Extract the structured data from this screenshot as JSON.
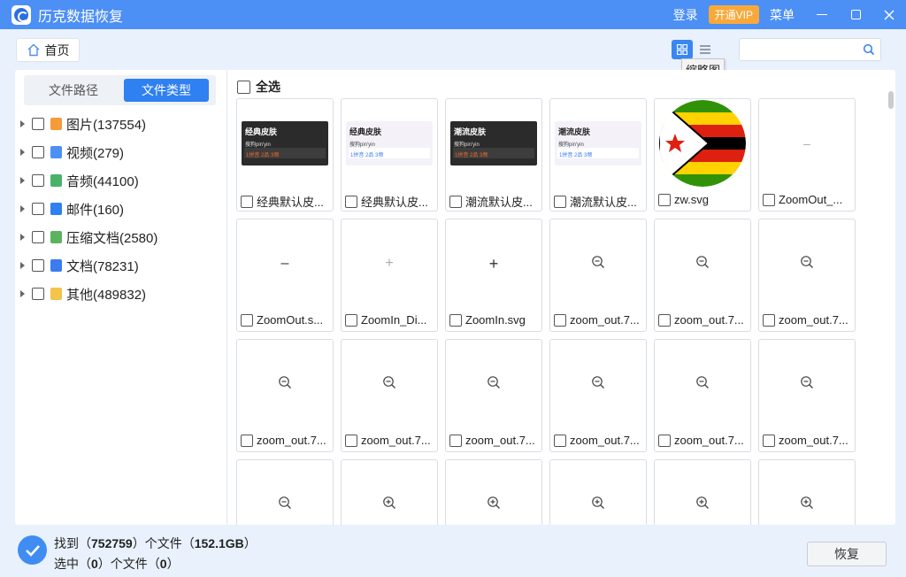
{
  "titlebar": {
    "app_title": "历克数据恢复",
    "login": "登录",
    "vip": "开通VIP",
    "menu": "菜单"
  },
  "toolbar": {
    "home": "首页",
    "tooltip": "缩略图",
    "search_value": "",
    "search_placeholder": ""
  },
  "left": {
    "tab_path": "文件路径",
    "tab_type": "文件类型",
    "items": [
      {
        "label": "图片(137554)",
        "icon": "image-icon",
        "color": "#f59b3a"
      },
      {
        "label": "视频(279)",
        "icon": "video-icon",
        "color": "#4c8ff5"
      },
      {
        "label": "音频(44100)",
        "icon": "audio-icon",
        "color": "#48b26a"
      },
      {
        "label": "邮件(160)",
        "icon": "mail-icon",
        "color": "#2f80f0"
      },
      {
        "label": "压缩文档(2580)",
        "icon": "archive-icon",
        "color": "#5bb35f"
      },
      {
        "label": "文档(78231)",
        "icon": "document-icon",
        "color": "#3b7cf1"
      },
      {
        "label": "其他(489832)",
        "icon": "folder-icon",
        "color": "#f3c34a"
      }
    ]
  },
  "grid": {
    "select_all": "全选",
    "skins": [
      {
        "title": "经典皮肤",
        "line": "搜狗pin'yin",
        "opts": "1拼音 2品 3频"
      },
      {
        "title": "经典皮肤",
        "line": "搜狗pin'yin",
        "opts": "1拼音 2品 3频"
      },
      {
        "title": "潮流皮肤",
        "line": "搜狗pin'yin",
        "opts": "1拼音 2品 3频"
      },
      {
        "title": "潮流皮肤",
        "line": "搜狗pin'yin",
        "opts": "1拼音 2品 3频"
      }
    ],
    "cards": [
      "经典默认皮...",
      "经典默认皮...",
      "潮流默认皮...",
      "潮流默认皮...",
      "zw.svg",
      "ZoomOut_...",
      "ZoomOut.s...",
      "ZoomIn_Di...",
      "ZoomIn.svg",
      "zoom_out.7...",
      "zoom_out.7...",
      "zoom_out.7...",
      "zoom_out.7...",
      "zoom_out.7...",
      "zoom_out.7...",
      "zoom_out.7...",
      "zoom_out.7...",
      "zoom_out.7..."
    ]
  },
  "status": {
    "found_prefix": "找到（",
    "found_count": "752759",
    "found_mid": "）个文件（",
    "found_size": "152.1GB",
    "found_suffix": "）",
    "selected_prefix": "选中（",
    "selected_count": "0",
    "selected_mid": "）个文件（",
    "selected_size": "0",
    "selected_suffix": "）",
    "recover": "恢复"
  },
  "colors": {
    "accent": "#4c8ff5",
    "vip": "#f8a93a"
  }
}
